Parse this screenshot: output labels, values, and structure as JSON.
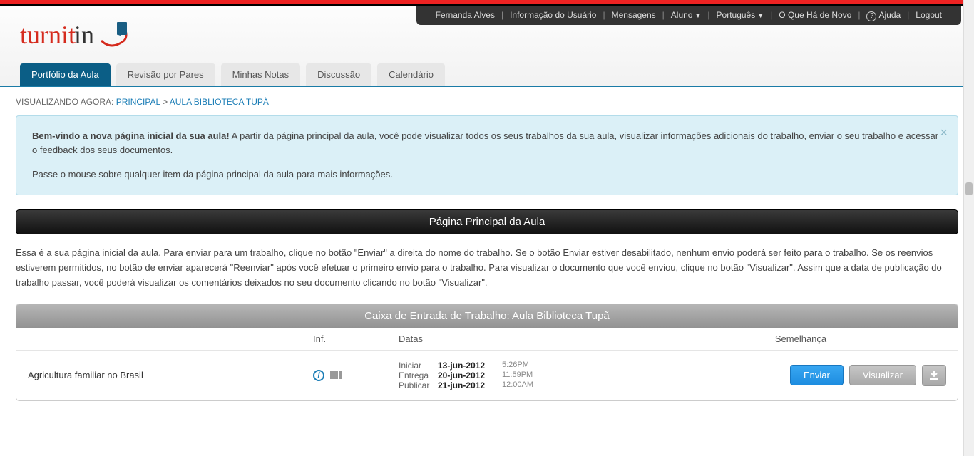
{
  "usernav": {
    "username": "Fernanda Alves",
    "user_info": "Informação do Usuário",
    "messages": "Mensagens",
    "role": "Aluno",
    "language": "Português",
    "whatsnew": "O Que Há de Novo",
    "help": "Ajuda",
    "logout": "Logout"
  },
  "logo": {
    "part1": "turnit",
    "part2": "in"
  },
  "tabs": {
    "portfolio": "Portfólio da Aula",
    "peer": "Revisão por Pares",
    "grades": "Minhas Notas",
    "discuss": "Discussão",
    "calendar": "Calendário"
  },
  "breadcrumb": {
    "label": "VISUALIZANDO AGORA:",
    "home": "PRINCIPAL",
    "sep": ">",
    "current": "AULA BIBLIOTECA TUPÃ"
  },
  "welcome": {
    "strong": "Bem-vindo a nova página inicial da sua aula!",
    "p1_rest": " A partir da página principal da aula, você pode visualizar todos os seus trabalhos da sua aula, visualizar informações adicionais do trabalho, enviar o seu trabalho e acessar o feedback dos seus documentos.",
    "p2": "Passe o mouse sobre qualquer item da página principal da aula para mais informações."
  },
  "page_title": "Página Principal da Aula",
  "description": "Essa é a sua página inicial da aula. Para enviar para um trabalho, clique no botão \"Enviar\" a direita do nome do trabalho. Se o botão Enviar estiver desabilitado, nenhum envio poderá ser feito para o trabalho. Se os reenvios estiverem permitidos, no botão de enviar aparecerá \"Reenviar\" após você efetuar o primeiro envio para o trabalho. Para visualizar o documento que você enviou, clique no botão \"Visualizar\". Assim que a data de publicação do trabalho passar, você poderá visualizar os comentários deixados no seu documento clicando no botão \"Visualizar\".",
  "inbox": {
    "title": "Caixa de Entrada de Trabalho: Aula Biblioteca Tupã",
    "headers": {
      "info": "Inf.",
      "dates": "Datas",
      "similarity": "Semelhança"
    },
    "row": {
      "name": "Agricultura familiar no Brasil",
      "start_label": "Iniciar",
      "due_label": "Entrega",
      "post_label": "Publicar",
      "start_date": "13-jun-2012",
      "start_time": "5:26PM",
      "due_date": "20-jun-2012",
      "due_time": "11:59PM",
      "post_date": "21-jun-2012",
      "post_time": "12:00AM"
    },
    "buttons": {
      "submit": "Enviar",
      "view": "Visualizar"
    }
  }
}
